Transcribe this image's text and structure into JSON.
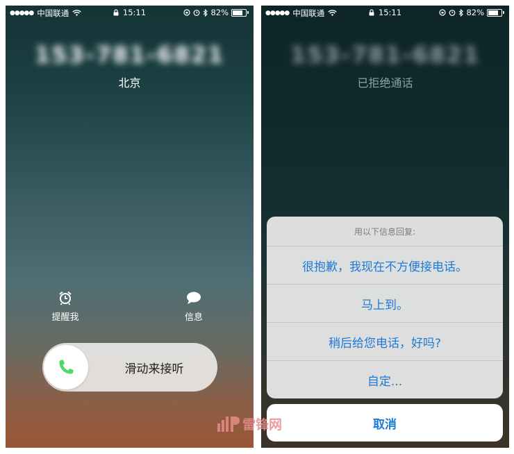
{
  "left_screen": {
    "status": {
      "carrier": "中国联通",
      "time": "15:11",
      "battery": "82%",
      "battery_level": 0.82
    },
    "caller_number": "153-781-6821",
    "location": "北京",
    "actions": {
      "remind_label": "提醒我",
      "message_label": "信息"
    },
    "slider_label": "滑动来接听"
  },
  "right_screen": {
    "status": {
      "carrier": "中国联通",
      "time": "15:11",
      "battery": "82%",
      "battery_level": 0.82
    },
    "caller_number": "153-781-6821",
    "call_status": "已拒绝通话",
    "reply_sheet": {
      "title": "用以下信息回复:",
      "options": [
        "很抱歉，我现在不方便接电话。",
        "马上到。",
        "稍后给您电话，好吗?",
        "自定..."
      ],
      "cancel_label": "取消"
    }
  },
  "watermark": {
    "text": "雷锋网"
  },
  "colors": {
    "ios_blue": "#1d7ad6",
    "call_green": "#4cd964"
  }
}
